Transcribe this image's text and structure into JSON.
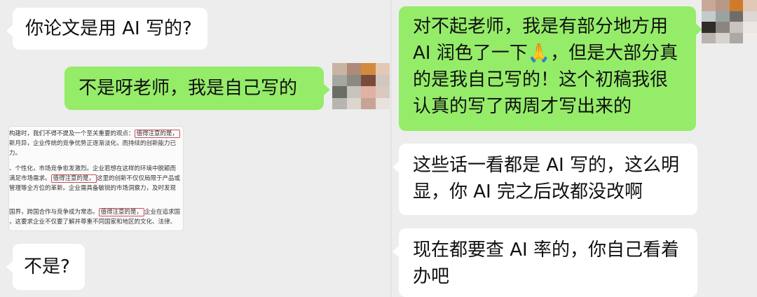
{
  "left_chat": {
    "msg1": "你论文是用 AI 写的?",
    "msg2": "不是呀老师，我是自己写的",
    "msg3": "不是?",
    "doc_screenshot": {
      "lines": [
        "构建时，我们不得不提及一个至关重要的观点：",
        "新月异，企业传统的竞争优势正逐渐淡化，而持续的创新能力已",
        "力。",
        "、个性化，市场竞争愈发激烈。企业若想在这样的环境中脱颖而",
        "满足市场需求。",
        "管理等全方位的革新。企业需具备敏锐的市场洞察力，及时发现",
        "国界，跨国合作与竞争成为常态。",
        "，这要求企业不仅要了解并尊重不同国家和地区的文化、法律、"
      ],
      "highlight": "值得注意的是，",
      "line5_tail": "这里的创新不仅仅局限于产品或",
      "line7_tail": "企业在追求国"
    }
  },
  "right_chat": {
    "msg1": "对不起老师，我是有部分地方用 AI 润色了一下🙏，但是大部分真的是我自己写的！这个初稿我很认真的写了两周才写出来的",
    "msg2": "这些话一看都是 AI 写的，这么明显，你 AI 完之后改都没改啊",
    "msg3": "现在都要查 AI 率的，你自己看着办吧"
  },
  "avatar_colors": {
    "left": [
      "#c9b3a3",
      "#b0897a",
      "#d28a3c",
      "#e5c8b4",
      "#a7a7a1",
      "#8a8a82",
      "#7a4b3a",
      "#cfc7c0",
      "#6a6e66",
      "#c8c3bd",
      "#e0b2a3",
      "#d9c9bf",
      "#b8b5b0",
      "#dcd6cf",
      "#c7a496",
      "#e8e1dc"
    ],
    "right": [
      "#c8a998",
      "#b89786",
      "#cf7b2e",
      "#e2c8b6",
      "#c4cbcc",
      "#9aa3a2",
      "#6f6d6b",
      "#dcd8d4",
      "#2f2c2a",
      "#8b8580",
      "#c9c4c0",
      "#e9e6e3",
      "#b9b4b0",
      "#d6d2ce",
      "#ada8a4",
      "#f0ecea"
    ]
  }
}
